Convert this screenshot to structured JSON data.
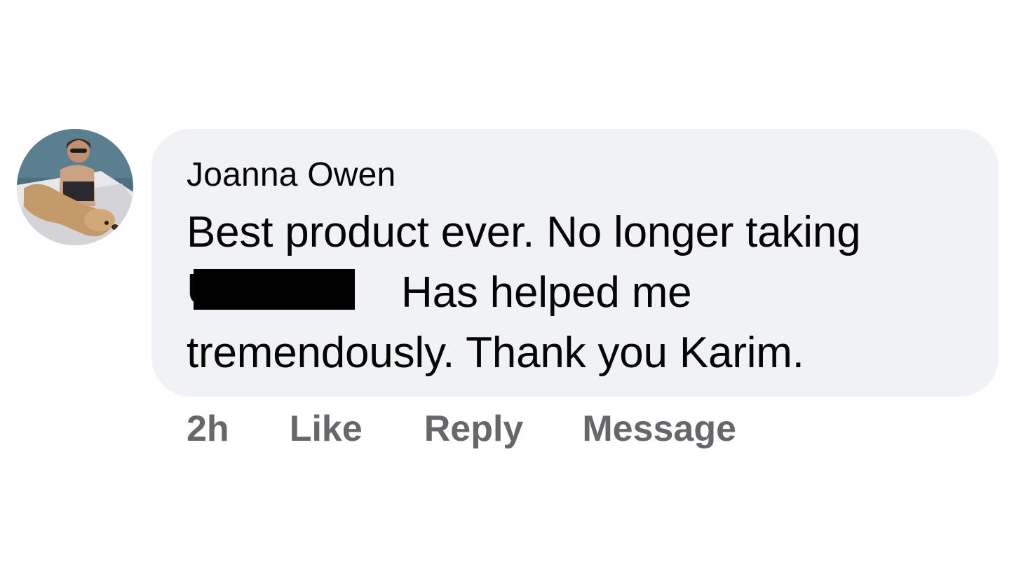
{
  "comment": {
    "author": "Joanna Owen",
    "text_line1": "Best product ever.  No longer taking",
    "text_line2_redacted_fragment": "U",
    "text_line2_rest": "Has helped me",
    "text_line3": "tremendously.  Thank you Karim.",
    "avatar_icon": "profile-photo"
  },
  "actions": {
    "timestamp": "2h",
    "like_label": "Like",
    "reply_label": "Reply",
    "message_label": "Message"
  },
  "colors": {
    "bubble_bg": "#f0f2f5",
    "text": "#050505",
    "meta_text": "#65676b",
    "redaction": "#000000"
  }
}
